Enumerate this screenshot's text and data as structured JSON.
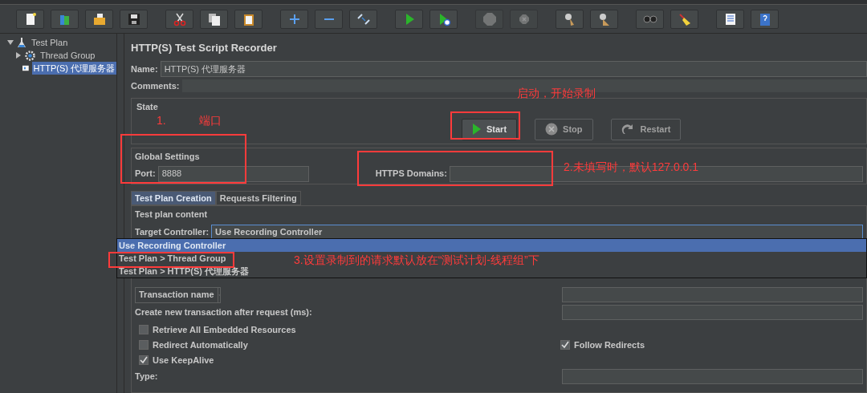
{
  "toolbar": [
    {
      "kind": "new",
      "disabled": false
    },
    {
      "kind": "templates",
      "disabled": false
    },
    {
      "kind": "open",
      "disabled": false
    },
    {
      "kind": "save",
      "disabled": false
    },
    {
      "kind": "cut",
      "disabled": false
    },
    {
      "kind": "copy",
      "disabled": false
    },
    {
      "kind": "paste",
      "disabled": false
    },
    {
      "kind": "expand",
      "disabled": false
    },
    {
      "kind": "collapse",
      "disabled": false
    },
    {
      "kind": "toggle",
      "disabled": false
    },
    {
      "kind": "start",
      "disabled": false
    },
    {
      "kind": "start-no-pause",
      "disabled": false
    },
    {
      "kind": "stop",
      "disabled": true
    },
    {
      "kind": "shutdown",
      "disabled": true
    },
    {
      "kind": "clear",
      "disabled": false
    },
    {
      "kind": "clear-all",
      "disabled": false
    },
    {
      "kind": "search",
      "disabled": false
    },
    {
      "kind": "reset",
      "disabled": false
    },
    {
      "kind": "functions",
      "disabled": false
    },
    {
      "kind": "help",
      "disabled": false
    }
  ],
  "tree": [
    {
      "kind": "plan",
      "label": "Test Plan",
      "expanded": true,
      "selected": false,
      "children": [
        {
          "kind": "thread-group",
          "label": "Thread Group",
          "expanded": false,
          "selected": false
        },
        {
          "kind": "proxy",
          "label": "HTTP(S) 代理服务器",
          "selected": true
        }
      ]
    }
  ],
  "panel": {
    "title": "HTTP(S) Test Script Recorder",
    "name_label": "Name:",
    "name_value": "HTTP(S) 代理服务器",
    "comments_label": "Comments:",
    "state": {
      "legend": "State",
      "buttons": [
        {
          "kind": "start",
          "label": "Start",
          "disabled": false
        },
        {
          "kind": "stop",
          "label": "Stop",
          "disabled": true
        },
        {
          "kind": "restart",
          "label": "Restart",
          "disabled": true
        }
      ]
    },
    "global": {
      "legend": "Global Settings",
      "port_label": "Port:",
      "port_value": "8888",
      "domains_label": "HTTPS Domains:"
    },
    "tabs": [
      {
        "label": "Test Plan Creation",
        "selected": true
      },
      {
        "label": "Requests Filtering",
        "selected": false
      }
    ],
    "content": {
      "legend": "Test plan content",
      "target_label": "Target Controller:",
      "target_value": "Use Recording Controller",
      "dropdown": [
        {
          "label": "Use Recording Controller",
          "selected": true
        },
        {
          "label": "Test Plan > Thread Group",
          "selected": false
        },
        {
          "label": "Test Plan > HTTP(S) 代理服务器",
          "selected": false
        }
      ]
    },
    "grouping": "Transaction name",
    "transaction_label": "Create new transaction after request (ms):",
    "options": [
      {
        "label": "Retrieve All Embedded Resources",
        "checked": false
      },
      {
        "label": "Redirect Automatically",
        "checked": false
      },
      {
        "label": "Use KeepAlive",
        "checked": true
      }
    ],
    "follow": {
      "label": "Follow Redirects",
      "checked": true
    },
    "type_label": "Type:"
  },
  "annotations": {
    "step1": "1.",
    "port": "端口",
    "start": "启动，开始录制",
    "domains": "2.未填写时，默认127.0.0.1",
    "target": "3.设置录制到的请求默认放在“测试计划-线程组”下"
  }
}
